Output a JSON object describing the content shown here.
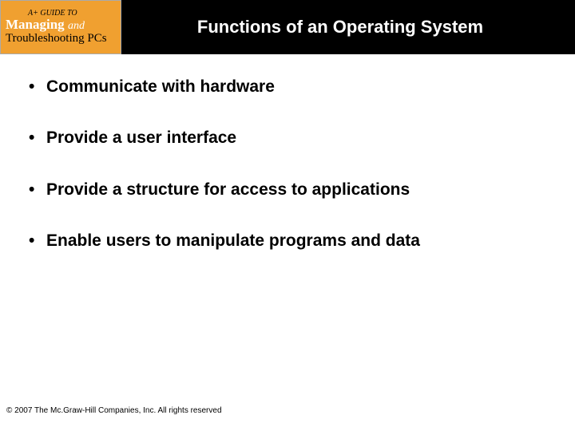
{
  "header": {
    "logo": {
      "line1": "A+ GUIDE TO",
      "line2_a": "Managing",
      "line2_b": "and",
      "line3": "Troubleshooting PCs"
    },
    "title": "Functions of an Operating System"
  },
  "bullets": {
    "items": [
      "Communicate with hardware",
      "Provide a user interface",
      "Provide a structure for access to applications",
      "Enable users to manipulate programs and data"
    ]
  },
  "footer": {
    "copyright": "© 2007 The Mc.Graw-Hill Companies, Inc. All rights reserved"
  }
}
